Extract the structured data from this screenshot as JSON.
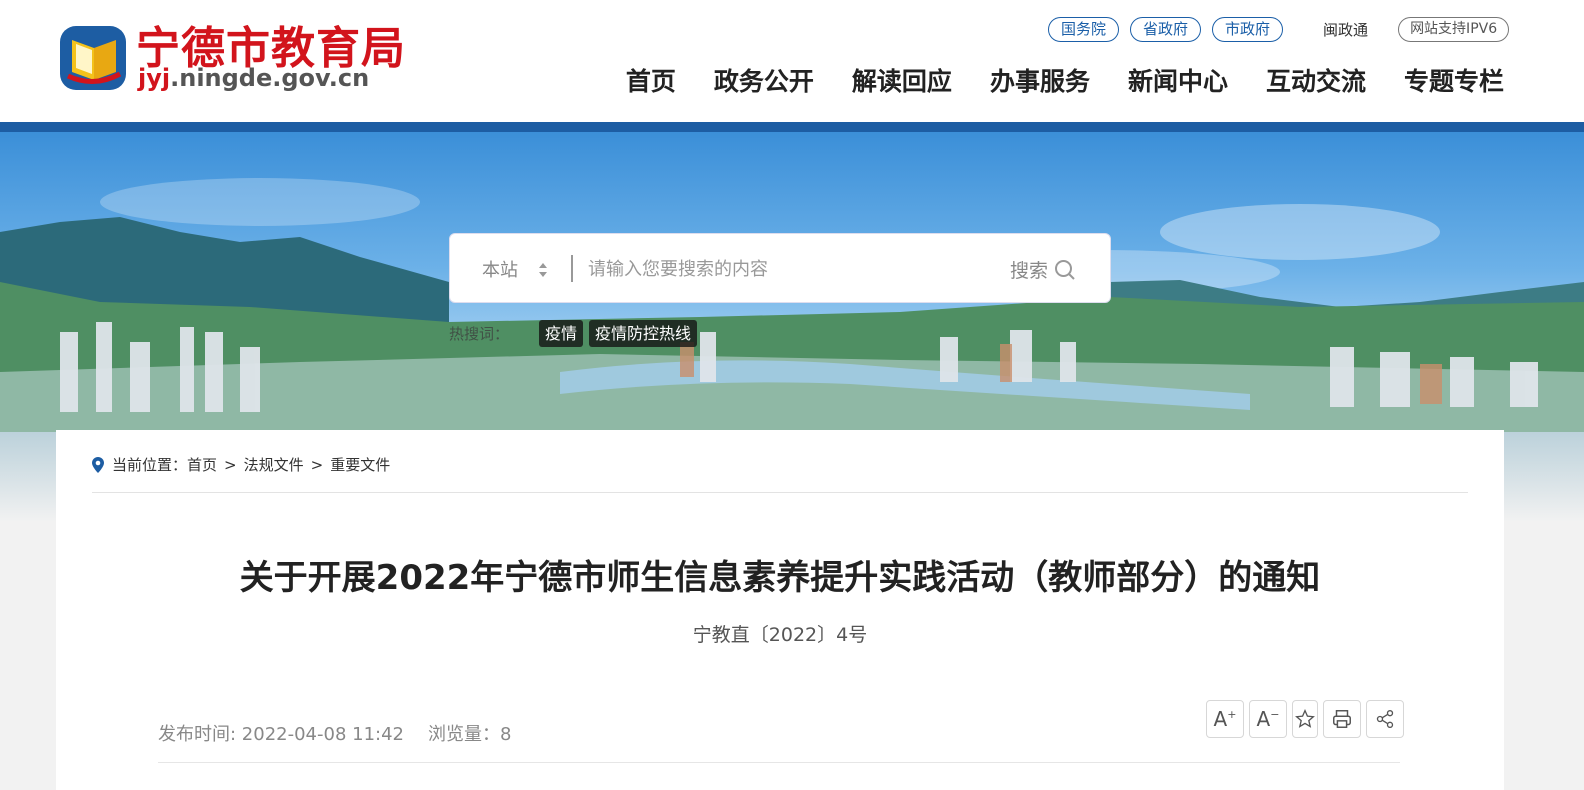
{
  "header": {
    "logo_title": "宁德市教育局",
    "logo_domain_prefix": "jyj",
    "logo_domain_rest": ".ningde.gov.cn",
    "top_links": [
      "国务院",
      "省政府",
      "市政府"
    ],
    "minzhengtong": "闽政通",
    "ipv6": "网站支持IPV6",
    "nav": [
      "首页",
      "政务公开",
      "解读回应",
      "办事服务",
      "新闻中心",
      "互动交流",
      "专题专栏"
    ]
  },
  "search": {
    "scope": "本站",
    "placeholder": "请输入您要搜索的内容",
    "button_label": "搜索",
    "hot_label": "热搜词：",
    "hot_tags": [
      "疫情",
      "疫情防控热线"
    ]
  },
  "breadcrumb": {
    "label": "当前位置：",
    "items": [
      "首页",
      "法规文件",
      "重要文件"
    ],
    "separator": ">"
  },
  "article": {
    "title": "关于开展2022年宁德市师生信息素养提升实践活动（教师部分）的通知",
    "doc_number": "宁教直〔2022〕4号",
    "publish_time": "发布时间: 2022-04-08 11:42",
    "views": "浏览量：8"
  },
  "tools": {
    "font_increase": "A",
    "font_decrease": "A",
    "icons": [
      "font-increase-icon",
      "font-decrease-icon",
      "star-icon",
      "print-icon",
      "share-icon"
    ]
  },
  "colors": {
    "brand_red": "#d2141c",
    "brand_blue": "#1d5da3"
  }
}
